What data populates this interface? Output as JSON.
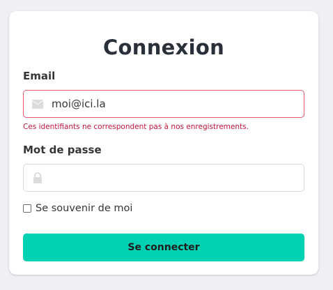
{
  "form": {
    "title": "Connexion",
    "email": {
      "label": "Email",
      "value": "moi@ici.la",
      "icon": "envelope-icon",
      "error": "Ces identifiants ne correspondent pas à nos enregistrements."
    },
    "password": {
      "label": "Mot de passe",
      "value": "",
      "icon": "lock-icon"
    },
    "remember": {
      "label": "Se souvenir de moi",
      "checked": false
    },
    "submit_label": "Se connecter"
  },
  "colors": {
    "accent": "#00d1b2",
    "error": "#c4143a",
    "error_border": "#e5546e"
  }
}
